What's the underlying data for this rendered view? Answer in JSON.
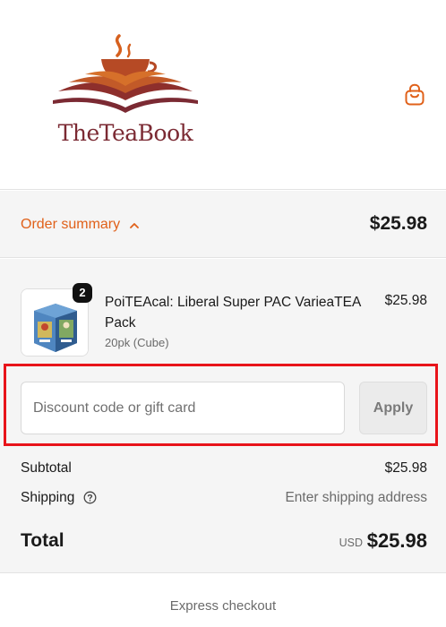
{
  "brand": {
    "name": "TheTeaBook",
    "colors": {
      "primary": "#7b2a33",
      "accent": "#e0611a",
      "flame": "#d6601e"
    }
  },
  "header": {
    "cart_icon": "shopping-bag-icon"
  },
  "summary": {
    "toggle_label": "Order summary",
    "toggle_icon": "chevron-up-icon",
    "total": "$25.98"
  },
  "line_items": [
    {
      "title": "PoiTEAcal: Liberal Super PAC VarieaTEA Pack",
      "variant": "20pk (Cube)",
      "price": "$25.98",
      "quantity": "2",
      "image": "product-cube-image"
    }
  ],
  "discount": {
    "placeholder": "Discount code or gift card",
    "value": "",
    "apply_label": "Apply"
  },
  "totals": {
    "subtotal_label": "Subtotal",
    "subtotal_value": "$25.98",
    "shipping_label": "Shipping",
    "shipping_icon": "help-circle-icon",
    "shipping_value": "Enter shipping address",
    "total_label": "Total",
    "currency": "USD",
    "total_value": "$25.98"
  },
  "express_checkout_label": "Express checkout"
}
